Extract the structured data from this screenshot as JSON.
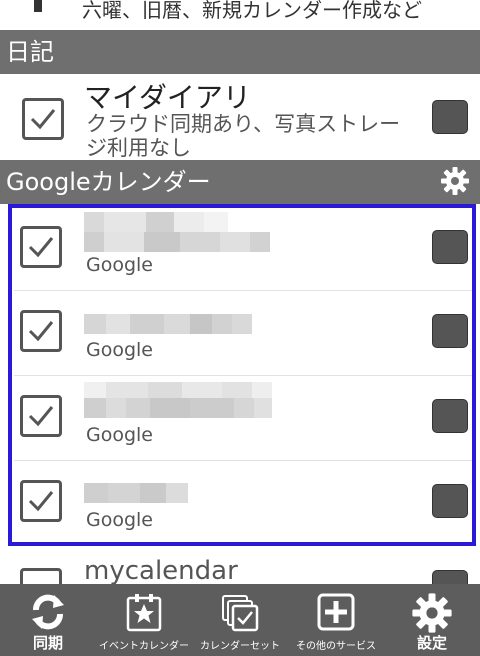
{
  "top_item": {
    "subtitle": "六曜、旧暦、新規カレンダー作成など"
  },
  "diary_section": {
    "header": "日記"
  },
  "diary_item": {
    "title": "マイダイアリ",
    "subtitle_line1": "クラウド同期あり、写真ストレー",
    "subtitle_line2": "ジ利用なし",
    "checked": true,
    "color": "#555555"
  },
  "google_section": {
    "header": "Googleカレンダー",
    "settings_icon": "gear-icon"
  },
  "google_calendars": [
    {
      "source": "Google",
      "checked": true,
      "color": "#555555"
    },
    {
      "source": "Google",
      "checked": true,
      "color": "#555555"
    },
    {
      "source": "Google",
      "checked": true,
      "color": "#555555"
    },
    {
      "source": "Google",
      "checked": true,
      "color": "#555555"
    }
  ],
  "partial_item": {
    "title": "mycalendar"
  },
  "toolbar": {
    "sync": {
      "label": "同期",
      "icon": "sync-icon"
    },
    "event_calendar": {
      "label": "イベントカレンダー",
      "icon": "star-calendar-icon"
    },
    "calendar_set": {
      "label": "カレンダーセット",
      "icon": "calendar-set-icon"
    },
    "other_services": {
      "label": "その他のサービス",
      "icon": "plus-icon"
    },
    "settings": {
      "label": "設定",
      "icon": "gear-icon"
    }
  },
  "colors": {
    "header_bg": "#6f6f6f",
    "toolbar_bg": "#5d5d5d",
    "highlight": "#2a1ad8"
  }
}
